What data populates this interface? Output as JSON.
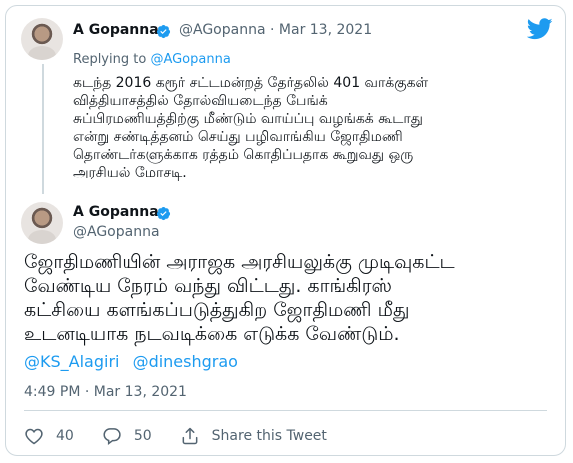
{
  "reply": {
    "author_name": "A Gopanna",
    "author_handle": "@AGopanna",
    "separator": "·",
    "date": "Mar 13, 2021",
    "replying_to_prefix": "Replying to",
    "replying_to_handle": "@AGopanna",
    "text": "கடந்த 2016 கரூர் சட்டமன்றத் தேர்தலில் 401 வாக்குகள்\nவித்தியாசத்தில் தோல்வியடைந்த  பேங்க்\nசுப்பிரமணியத்திற்கு மீண்டும் வாய்ப்பு வழங்கக் கூடாது\nஎன்று சண்டித்தனம் செய்து பழிவாங்கிய ஜோதிமணி\nதொண்டர்களுக்காக ரத்தம் கொதிப்பதாக கூறுவது ஒரு\nஅரசியல் மோசடி."
  },
  "main": {
    "author_name": "A Gopanna",
    "author_handle": "@AGopanna",
    "text": "ஜோதிமணியின் அராஜக அரசியலுக்கு முடிவுகட்ட\nவேண்டிய நேரம் வந்து விட்டது. காங்கிரஸ்\nகட்சியை களங்கப்படுத்துகிற ஜோதிமணி மீது\nஉடனடியாக நடவடிக்கை எடுக்க வேண்டும்.",
    "mentions": [
      "@KS_Alagiri",
      "@dineshgrao"
    ],
    "time": "4:49 PM · Mar 13, 2021"
  },
  "actions": {
    "likes": "40",
    "replies": "50",
    "share_label": "Share this Tweet"
  },
  "colors": {
    "accent": "#1d9bf0",
    "muted": "#536471",
    "text": "#0f1419",
    "border": "#cfd9de"
  },
  "icons": [
    "verified-badge-icon",
    "twitter-bird-icon",
    "heart-icon",
    "reply-icon",
    "share-icon"
  ]
}
